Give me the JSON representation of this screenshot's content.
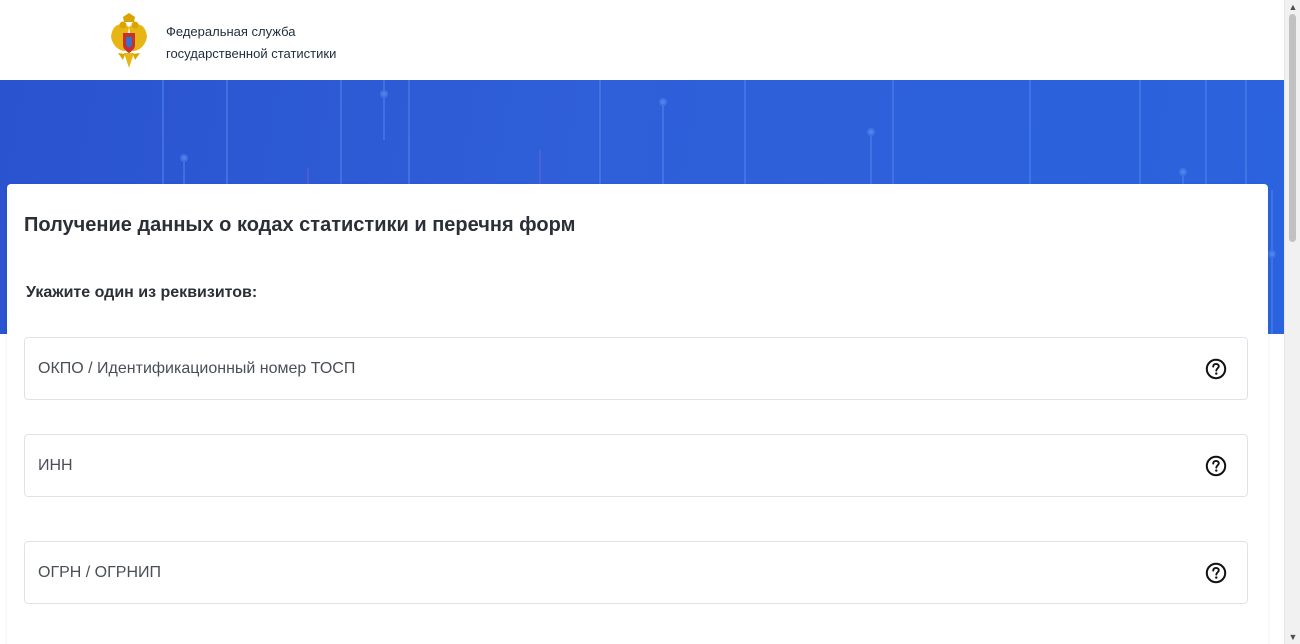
{
  "header": {
    "org_line1": "Федеральная служба",
    "org_line2": "государственной статистики",
    "emblem_icon": "emblem-icon"
  },
  "banner": {
    "color": "#2d5bd5"
  },
  "form": {
    "title": "Получение данных о кодах статистики и перечня форм",
    "subtitle": "Укажите один из реквизитов:",
    "fields": [
      {
        "placeholder": "ОКПО / Идентификационный номер ТОСП",
        "help_icon": "question-circle-icon"
      },
      {
        "placeholder": "ИНН",
        "help_icon": "question-circle-icon"
      },
      {
        "placeholder": "ОГРН / ОГРНИП",
        "help_icon": "question-circle-icon"
      }
    ]
  },
  "colors": {
    "accent": "#2d5bd5",
    "text": "#2b2f36",
    "field_border": "#dfe3e8"
  }
}
